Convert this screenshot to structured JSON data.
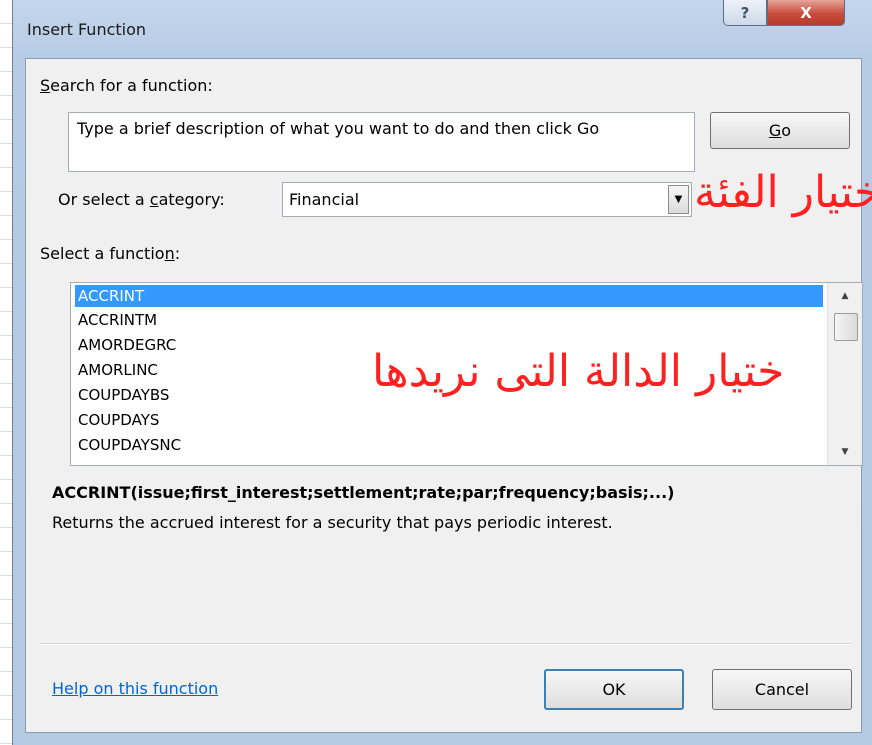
{
  "window": {
    "title": "Insert Function",
    "help_glyph": "?",
    "close_glyph": "X"
  },
  "search": {
    "label_pre": "",
    "label_ul": "S",
    "label_post": "earch for a function:",
    "value": "Type a brief description of what you want to do and then click Go",
    "go_pre": "",
    "go_ul": "G",
    "go_post": "o"
  },
  "category": {
    "label_pre": "Or select a ",
    "label_ul": "c",
    "label_post": "ategory:",
    "value": "Financial"
  },
  "functions": {
    "label_pre": "Select a functio",
    "label_ul": "n",
    "label_post": ":",
    "items": [
      "ACCRINT",
      "ACCRINTM",
      "AMORDEGRC",
      "AMORLINC",
      "COUPDAYBS",
      "COUPDAYS",
      "COUPDAYSNC"
    ],
    "selected_index": 0
  },
  "annotations": {
    "category_note": "ختيار الفئة",
    "function_note": "ختيار الدالة التى نريدها"
  },
  "details": {
    "syntax": "ACCRINT(issue;first_interest;settlement;rate;par;frequency;basis;...)",
    "description": "Returns the accrued interest for a security that pays periodic interest."
  },
  "footer": {
    "help_link": "Help on this function",
    "ok_label": "OK",
    "cancel_label": "Cancel"
  },
  "colors": {
    "selection": "#3399ff",
    "annotation": "#ff2020",
    "link": "#0066cc",
    "close_button": "#c94b3b"
  }
}
